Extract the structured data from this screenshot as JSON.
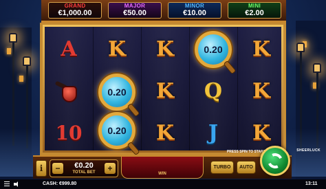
{
  "game": {
    "brand": "SHEERLUCK"
  },
  "jackpots": [
    {
      "label": "GRAND",
      "value": "€1,000.00"
    },
    {
      "label": "MAJOR",
      "value": "€50.00"
    },
    {
      "label": "MINOR",
      "value": "€10.00"
    },
    {
      "label": "MINI",
      "value": "€2.00"
    }
  ],
  "reels": {
    "rows": [
      [
        "A",
        "K",
        "K",
        "0.20",
        "K"
      ],
      [
        "pipe",
        "0.20",
        "K",
        "Q",
        "K"
      ],
      [
        "10",
        "0.20",
        "K",
        "J",
        "K"
      ]
    ],
    "multipliers": {
      "r0c3": "0.20",
      "r1c1": "0.20",
      "r2c1": "0.20"
    }
  },
  "controls": {
    "info_label": "i",
    "bet_minus": "−",
    "bet_plus": "+",
    "bet_value": "€0.20",
    "bet_label": "TOTAL BET",
    "win_label": "WIN",
    "prompt": "PRESS SPIN TO START GAME",
    "turbo_label": "TURBO",
    "auto_label": "AUTO"
  },
  "status": {
    "cash_label": "CASH:",
    "cash_value": "€999.80",
    "time": "13:11"
  }
}
